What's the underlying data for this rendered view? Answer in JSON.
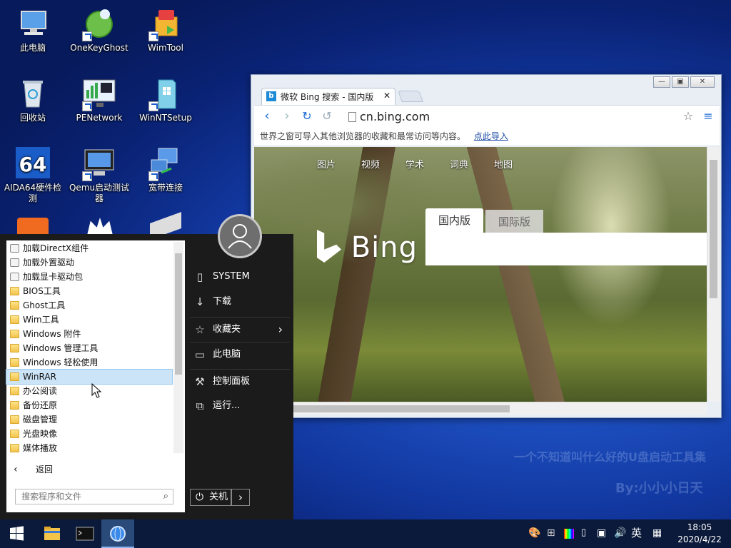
{
  "desktop": {
    "icons": [
      {
        "label": "此电脑",
        "icon": "computer-icon"
      },
      {
        "label": "OneKeyGhost",
        "icon": "ghost-icon"
      },
      {
        "label": "WimTool",
        "icon": "wim-icon"
      },
      {
        "label": "回收站",
        "icon": "recycle-bin-icon"
      },
      {
        "label": "PENetwork",
        "icon": "network-monitor-icon"
      },
      {
        "label": "WinNTSetup",
        "icon": "setup-icon"
      },
      {
        "label": "AIDA64硬件检测",
        "icon": "aida64-icon"
      },
      {
        "label": "Qemu启动测试器",
        "icon": "qemu-icon"
      },
      {
        "label": "宽带连接",
        "icon": "broadband-icon"
      }
    ],
    "watermark_line1": "一个不知道叫什么好的U盘启动工具集",
    "watermark_line2": "By:小小小日天"
  },
  "browser": {
    "tab_title": "微软 Bing 搜索 - 国内版",
    "url": "cn.bing.com",
    "bookmarks_msg": "世界之窗可导入其他浏览器的收藏和最常访问等内容。",
    "bookmarks_link": "点此导入",
    "page": {
      "nav": [
        "图片",
        "视频",
        "学术",
        "词典",
        "地图"
      ],
      "logo": "Bing",
      "tab_domestic": "国内版",
      "tab_international": "国际版"
    }
  },
  "start_menu": {
    "programs": [
      {
        "label": "加载DirectX组件",
        "type": "gear"
      },
      {
        "label": "加载外置驱动",
        "type": "gear"
      },
      {
        "label": "加载显卡驱动包",
        "type": "gear"
      },
      {
        "label": "BIOS工具",
        "type": "folder"
      },
      {
        "label": "Ghost工具",
        "type": "folder"
      },
      {
        "label": "Wim工具",
        "type": "folder"
      },
      {
        "label": "Windows 附件",
        "type": "folder"
      },
      {
        "label": "Windows 管理工具",
        "type": "folder"
      },
      {
        "label": "Windows 轻松使用",
        "type": "folder"
      },
      {
        "label": "WinRAR",
        "type": "folder"
      },
      {
        "label": "办公阅读",
        "type": "folder"
      },
      {
        "label": "备份还原",
        "type": "folder"
      },
      {
        "label": "磁盘管理",
        "type": "folder"
      },
      {
        "label": "光盘映像",
        "type": "folder"
      },
      {
        "label": "媒体播放",
        "type": "folder"
      }
    ],
    "back_label": "返回",
    "search_placeholder": "搜索程序和文件",
    "right_items": {
      "system": "SYSTEM",
      "downloads": "下载",
      "favorites": "收藏夹",
      "this_pc": "此电脑",
      "control_panel": "控制面板",
      "run": "运行..."
    },
    "shutdown_label": "关机"
  },
  "taskbar": {
    "ime": "英",
    "time": "18:05",
    "date": "2020/4/22"
  },
  "colors": {
    "accent": "#1c6ad6",
    "taskbar": "#0b1a3a",
    "start_menu": "#1b1b1b"
  }
}
